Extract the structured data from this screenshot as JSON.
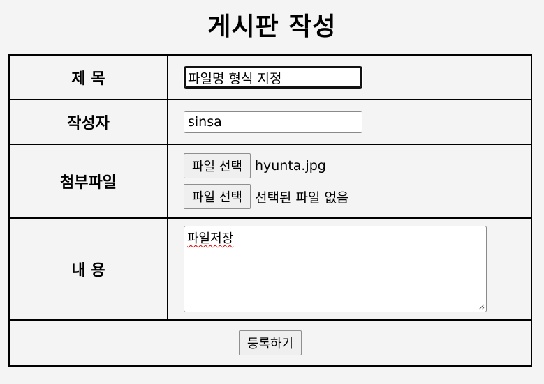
{
  "page": {
    "title": "게시판 작성"
  },
  "form": {
    "title_label": "제 목",
    "title_value": "파일명 형식 지정",
    "author_label": "작성자",
    "author_value": "sinsa",
    "files_label": "첨부파일",
    "files": [
      {
        "button_label": "파일 선택",
        "file_name": "hyunta.jpg"
      },
      {
        "button_label": "파일 선택",
        "file_name": "선택된 파일 없음"
      }
    ],
    "content_label": "내 용",
    "content_value": "파일저장",
    "submit_label": "등록하기"
  }
}
